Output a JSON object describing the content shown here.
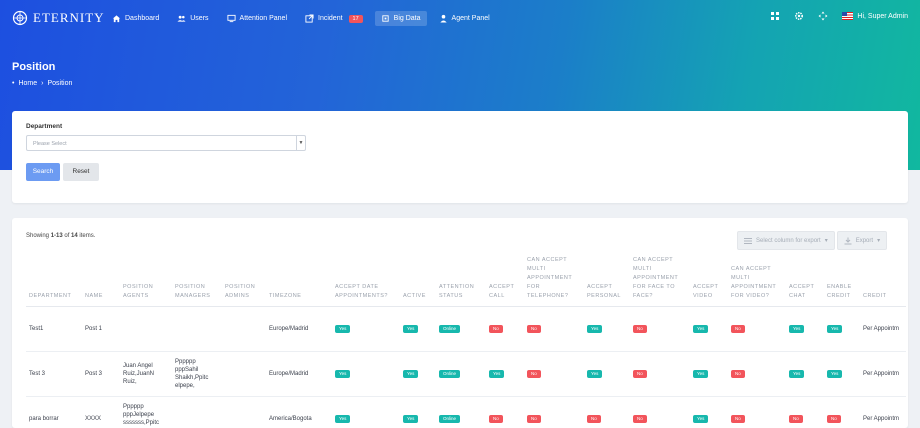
{
  "app": {
    "name": "ETERNITY"
  },
  "nav": [
    {
      "label": "Dashboard",
      "icon": "home-icon"
    },
    {
      "label": "Users",
      "icon": "users-icon"
    },
    {
      "label": "Attention Panel",
      "icon": "monitor-icon"
    },
    {
      "label": "Incident",
      "icon": "external-icon",
      "badge": "17"
    },
    {
      "label": "Big Data",
      "icon": "chip-icon",
      "active": true
    },
    {
      "label": "Agent Panel",
      "icon": "agent-icon"
    }
  ],
  "user": {
    "name": "Hi, Super Admin"
  },
  "page": {
    "title": "Position",
    "breadcrumb": [
      "Home",
      "Position"
    ]
  },
  "filter": {
    "department_label": "Department",
    "department_placeholder": "Please Select",
    "search_label": "Search",
    "reset_label": "Reset"
  },
  "summary": {
    "prefix": "Showing ",
    "range": "1-13",
    "middle": " of ",
    "total": "14",
    "suffix": " items."
  },
  "toolbar": {
    "columns_label": "Select column for export",
    "export_label": "Export"
  },
  "table": {
    "columns": [
      "Department",
      "Name",
      "Position Agents",
      "Position Managers",
      "Position Admins",
      "Timezone",
      "Accept Date Appointments?",
      "Active",
      "Attention Status",
      "Accept Call",
      "Can Accept Multi Appointment For Telephone?",
      "Accept Personal",
      "Can Accept Multi Appointment For Face To Face?",
      "Accept Video",
      "Can Accept Multi Appointment For Video?",
      "Accept Chat",
      "Enable Credit",
      "Credit"
    ],
    "rows": [
      {
        "department": "Test1",
        "name": "Post 1",
        "agents": "",
        "managers": "",
        "admins": "",
        "timezone": "Europe/Madrid",
        "accept_date": "Yes",
        "active": "Yes",
        "attention": "Online",
        "accept_call": "No",
        "multi_tel": "No",
        "accept_personal": "Yes",
        "multi_face": "No",
        "accept_video": "Yes",
        "multi_video": "No",
        "accept_chat": "Yes",
        "enable_credit": "Yes",
        "credit": "Per Appointm"
      },
      {
        "department": "Test 3",
        "name": "Post 3",
        "agents": "Juan Angel Ruiz,JuanN Ruiz,",
        "managers": "Pppppp pppSahil Shaikh,Ppitc elpepe,",
        "admins": "",
        "timezone": "Europe/Madrid",
        "accept_date": "Yes",
        "active": "Yes",
        "attention": "Online",
        "accept_call": "Yes",
        "multi_tel": "No",
        "accept_personal": "Yes",
        "multi_face": "No",
        "accept_video": "Yes",
        "multi_video": "No",
        "accept_chat": "Yes",
        "enable_credit": "Yes",
        "credit": "Per Appointm"
      },
      {
        "department": "para borrar",
        "name": "XXXX",
        "agents": "Pppppp pppJelpepe sssssss,Ppitc elpepe,",
        "managers": "",
        "admins": "",
        "timezone": "America/Bogota",
        "accept_date": "Yes",
        "active": "Yes",
        "attention": "Online",
        "accept_call": "No",
        "multi_tel": "No",
        "accept_personal": "No",
        "multi_face": "No",
        "accept_video": "Yes",
        "multi_video": "No",
        "accept_chat": "No",
        "enable_credit": "No",
        "credit": "Per Appointm"
      }
    ]
  },
  "colors": {
    "hero_start": "#1d4fe0",
    "hero_end": "#11b89f",
    "primary": "#6c9bf2",
    "yes": "#17b8ad",
    "no": "#f2545b"
  }
}
